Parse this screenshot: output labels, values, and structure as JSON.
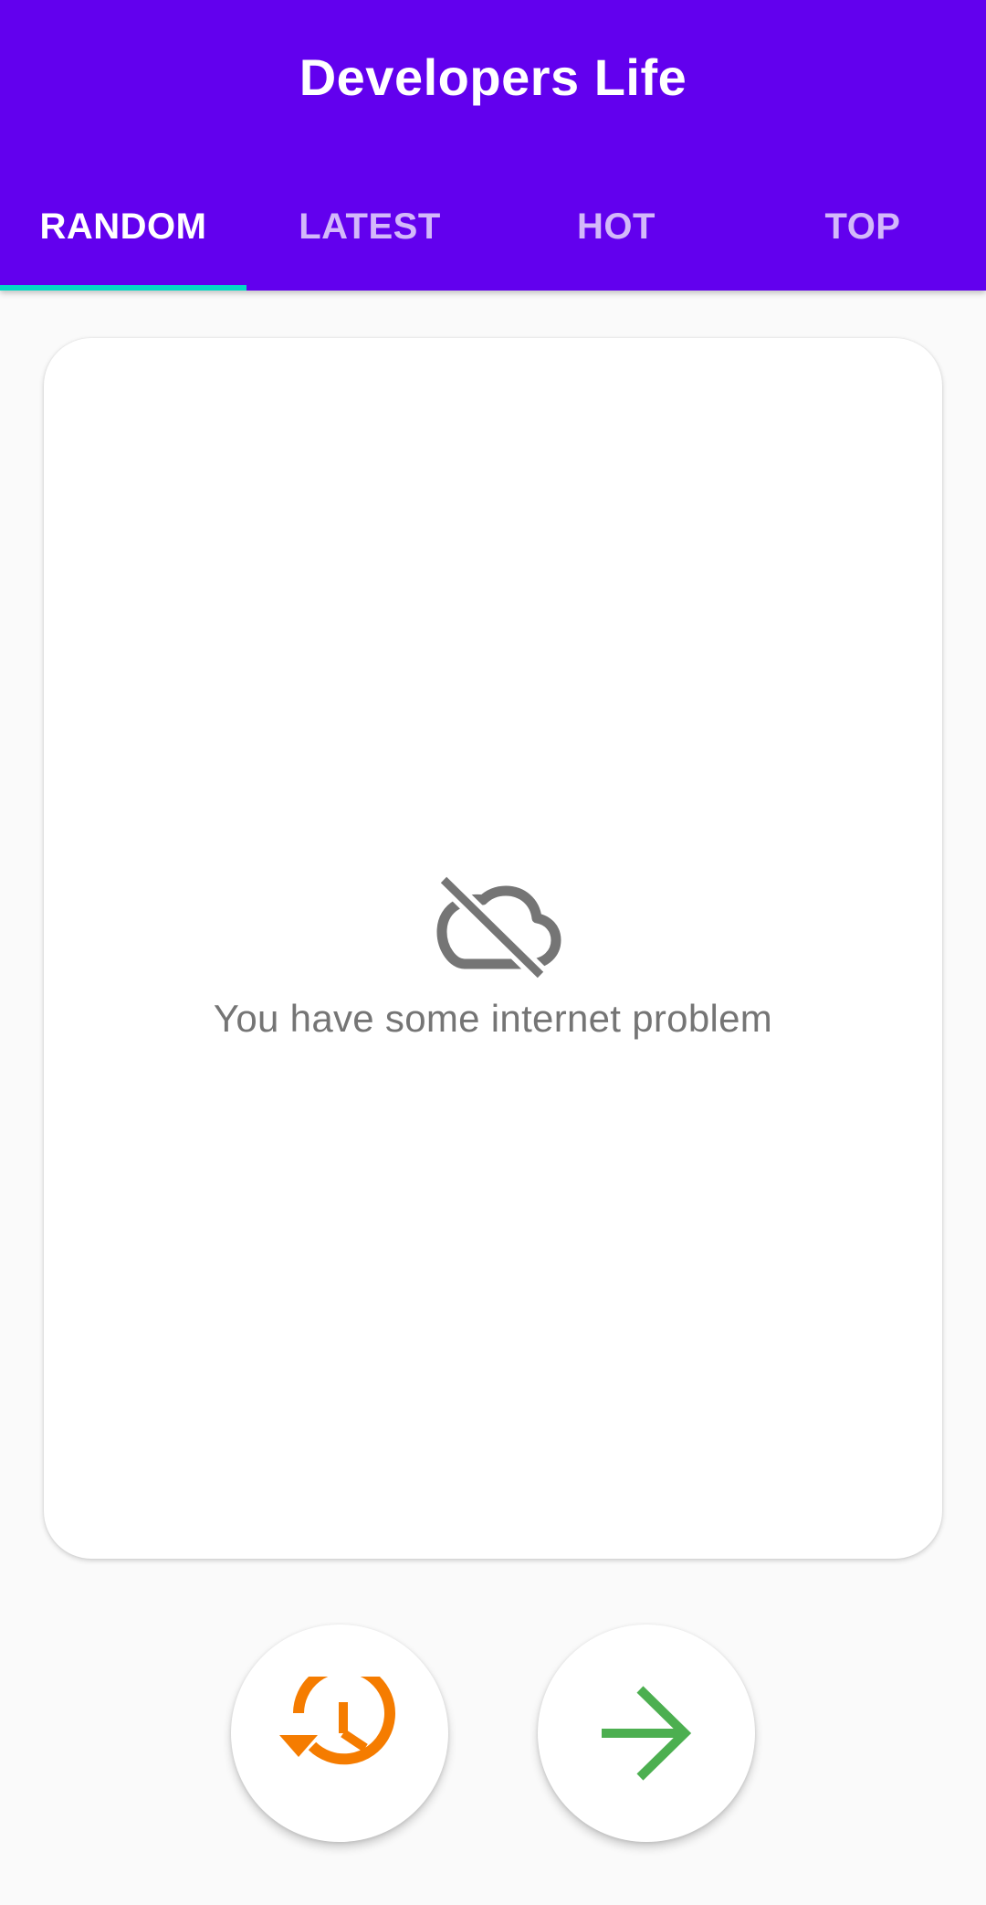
{
  "app": {
    "title": "Developers Life"
  },
  "tabs": [
    {
      "label": "RANDOM",
      "selected": true
    },
    {
      "label": "LATEST",
      "selected": false
    },
    {
      "label": "HOT",
      "selected": false
    },
    {
      "label": "TOP",
      "selected": false
    }
  ],
  "card": {
    "error_icon": "cloud-off-icon",
    "error_text": "You have some internet problem"
  },
  "actions": {
    "history_icon": "history-icon",
    "next_icon": "arrow-forward-icon"
  },
  "colors": {
    "primary": "#6200ee",
    "tab_indicator": "#03dac5",
    "history_icon": "#f57c00",
    "next_icon": "#4caf50",
    "error_gray": "#757575"
  }
}
